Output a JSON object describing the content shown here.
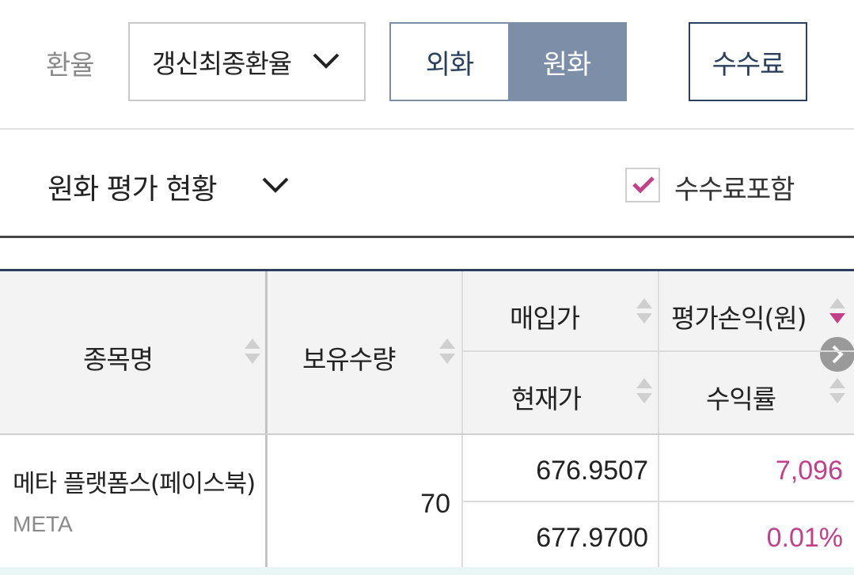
{
  "controls": {
    "rate_label": "환율",
    "rate_select_value": "갱신최종환율",
    "currency_toggle": [
      "외화",
      "원화"
    ],
    "currency_selected": "원화",
    "fee_button": "수수료"
  },
  "section": {
    "title": "원화 평가 현황",
    "fee_include_label": "수수료포함",
    "fee_include_checked": true
  },
  "table": {
    "headers": {
      "name": "종목명",
      "quantity": "보유수량",
      "buy_price": "매입가",
      "current_price": "현재가",
      "pnl": "평가손익(원)",
      "return_rate": "수익률"
    },
    "rows": [
      {
        "name": "메타 플랫폼스(페이스북)",
        "ticker": "META",
        "quantity": "70",
        "buy_price": "676.9507",
        "current_price": "677.9700",
        "pnl": "7,096",
        "return_rate": "0.01%"
      }
    ]
  },
  "colors": {
    "accent_navy": "#2b3f5f",
    "toggle_active": "#7c8ea8",
    "profit_pink": "#c2408a"
  }
}
